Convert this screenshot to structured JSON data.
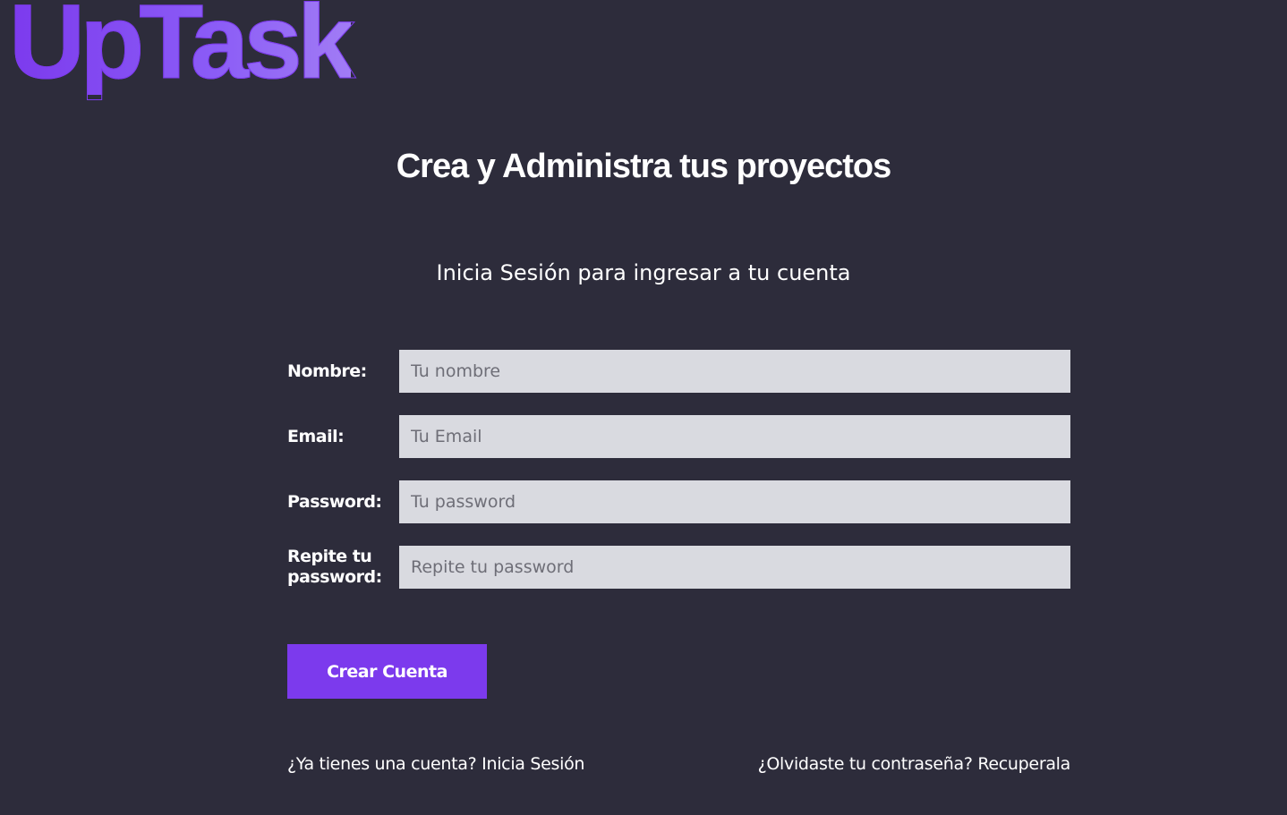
{
  "brand": {
    "logo_text": "UpTask",
    "accent_color": "#7c3aed"
  },
  "header": {
    "tagline": "Crea y Administra tus proyectos"
  },
  "main": {
    "subtitle": "Inicia Sesión para ingresar a tu cuenta",
    "form": {
      "fields": [
        {
          "label": "Nombre:",
          "placeholder": "Tu nombre",
          "value": ""
        },
        {
          "label": "Email:",
          "placeholder": "Tu Email",
          "value": ""
        },
        {
          "label": "Password:",
          "placeholder": "Tu password",
          "value": ""
        },
        {
          "label": "Repite tu password:",
          "placeholder": "Repite tu password",
          "value": ""
        }
      ],
      "submit_label": "Crear Cuenta"
    },
    "links": {
      "login": "¿Ya tienes una cuenta? Inicia Sesión",
      "recover": "¿Olvidaste tu contraseña? Recuperala"
    }
  },
  "colors": {
    "background": "#2d2c3b",
    "input_background": "#d9dae0",
    "button": "#7c3aed"
  }
}
